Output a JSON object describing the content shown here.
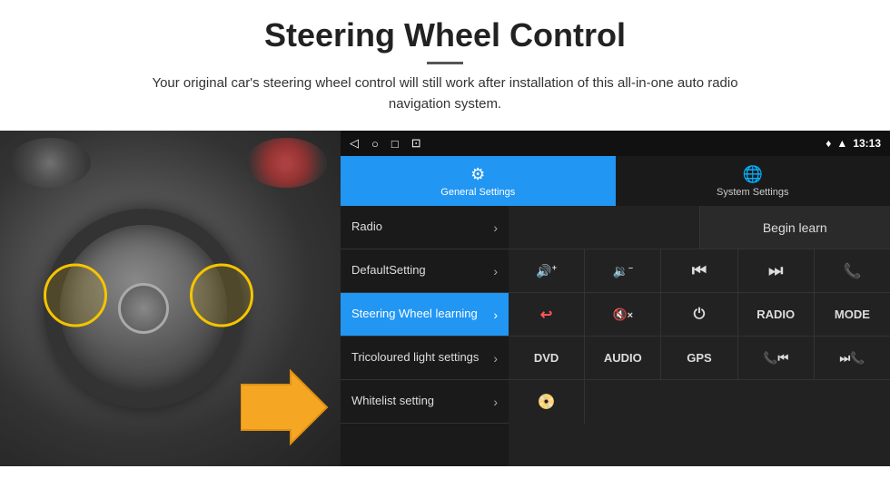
{
  "header": {
    "title": "Steering Wheel Control",
    "subtitle": "Your original car's steering wheel control will still work after installation of this all-in-one auto radio navigation system."
  },
  "status_bar": {
    "time": "13:13",
    "icons": [
      "◁",
      "○",
      "□",
      "⊡"
    ]
  },
  "tabs": [
    {
      "id": "general",
      "label": "General Settings",
      "active": true
    },
    {
      "id": "system",
      "label": "System Settings",
      "active": false
    }
  ],
  "menu_items": [
    {
      "id": "radio",
      "label": "Radio",
      "active": false
    },
    {
      "id": "default",
      "label": "DefaultSetting",
      "active": false
    },
    {
      "id": "steering",
      "label": "Steering Wheel learning",
      "active": true
    },
    {
      "id": "tricoloured",
      "label": "Tricoloured light settings",
      "active": false
    },
    {
      "id": "whitelist",
      "label": "Whitelist setting",
      "active": false
    }
  ],
  "controls": {
    "begin_learn_label": "Begin learn",
    "row1": [
      {
        "id": "vol_up",
        "label": "🔊+",
        "type": "icon"
      },
      {
        "id": "vol_down",
        "label": "🔉–",
        "type": "icon"
      },
      {
        "id": "prev",
        "label": "⏮",
        "type": "icon"
      },
      {
        "id": "next",
        "label": "⏭",
        "type": "icon"
      },
      {
        "id": "phone",
        "label": "📞",
        "type": "icon"
      }
    ],
    "row2": [
      {
        "id": "hang_up",
        "label": "↪",
        "type": "icon"
      },
      {
        "id": "mute",
        "label": "🔇×",
        "type": "icon"
      },
      {
        "id": "power",
        "label": "⏻",
        "type": "icon"
      },
      {
        "id": "radio_btn",
        "label": "RADIO",
        "type": "text"
      },
      {
        "id": "mode_btn",
        "label": "MODE",
        "type": "text"
      }
    ],
    "row3": [
      {
        "id": "dvd_btn",
        "label": "DVD",
        "type": "text"
      },
      {
        "id": "audio_btn",
        "label": "AUDIO",
        "type": "text"
      },
      {
        "id": "gps_btn",
        "label": "GPS",
        "type": "text"
      },
      {
        "id": "phone2",
        "label": "📞⏮",
        "type": "icon"
      },
      {
        "id": "skip2",
        "label": "⏭📞",
        "type": "icon"
      }
    ],
    "row4": [
      {
        "id": "dvd_icon",
        "label": "📀",
        "type": "icon"
      }
    ]
  }
}
